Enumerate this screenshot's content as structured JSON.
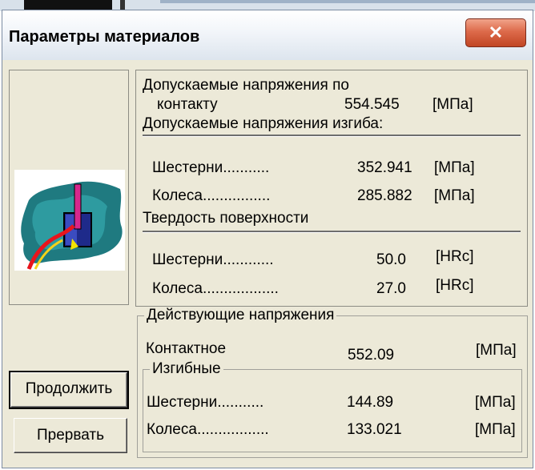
{
  "window": {
    "title": "Параметры материалов",
    "close_icon": "close-icon"
  },
  "allowable": {
    "contact_label_1": "Допускаемые напряжения по",
    "contact_label_2": "контакту",
    "contact_value": "554.545",
    "contact_unit": "[МПа]",
    "bending_label": "Допускаемые напряжения изгиба:",
    "bending_gear_label": "Шестерни...........",
    "bending_gear_value": "352.941",
    "bending_gear_unit": "[МПа]",
    "bending_wheel_label": "Колеса................",
    "bending_wheel_value": "285.882",
    "bending_wheel_unit": "[МПа]",
    "hardness_label": "Твердость поверхности",
    "hardness_gear_label": "Шестерни............",
    "hardness_gear_value": "50.0",
    "hardness_gear_unit": "[HRc]",
    "hardness_wheel_label": "Колеса..................",
    "hardness_wheel_value": "27.0",
    "hardness_wheel_unit": "[HRc]"
  },
  "acting": {
    "group_title": "Действующие напряжения",
    "contact_label": "Контактное",
    "contact_value": "552.09",
    "contact_unit": "[МПа]",
    "bending_group_title": "Изгибные",
    "gear_label": "Шестерни...........",
    "gear_value": "144.89",
    "gear_unit": "[МПа]",
    "wheel_label": "Колеса.................",
    "wheel_value": "133.021",
    "wheel_unit": "[МПа]"
  },
  "buttons": {
    "continue": "Продолжить",
    "abort": "Прервать"
  },
  "illustration": "material-hardening-icon"
}
